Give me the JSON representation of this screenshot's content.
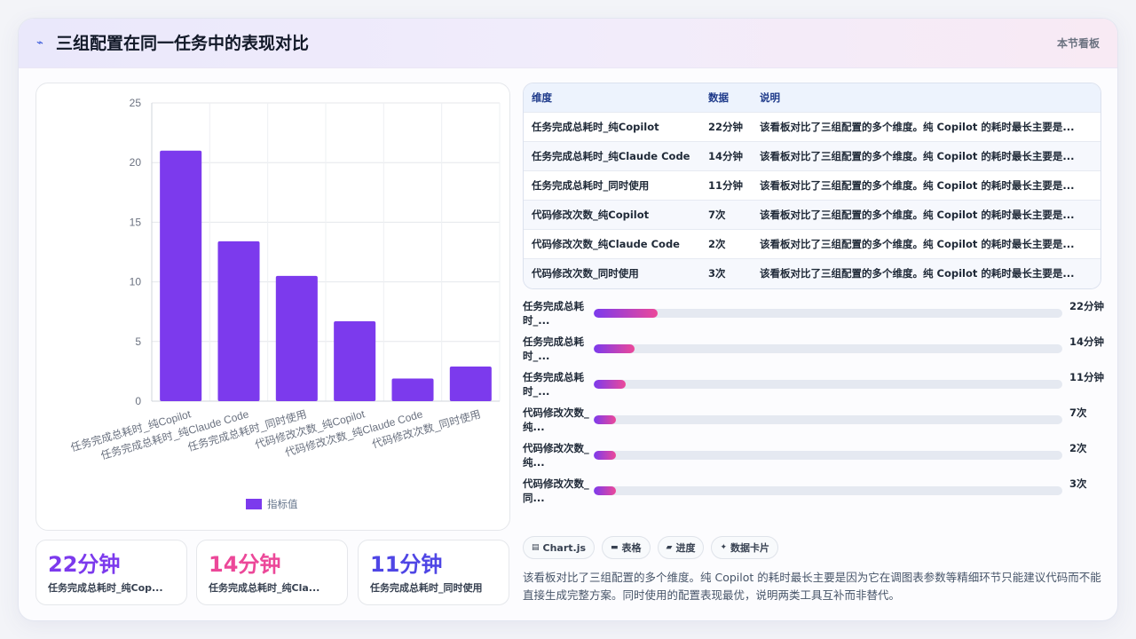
{
  "header": {
    "icon": "trend-icon",
    "title": "三组配置在同一任务中的表现对比",
    "tag": "本节看板"
  },
  "chart_data": {
    "type": "bar",
    "categories": [
      "任务完成总耗时_纯Copilot",
      "任务完成总耗时_纯Claude Code",
      "任务完成总耗时_同时使用",
      "代码修改次数_纯Copilot",
      "代码修改次数_纯Claude Code",
      "代码修改次数_同时使用"
    ],
    "series": [
      {
        "name": "指标值",
        "values": [
          21,
          13.4,
          10.5,
          6.7,
          1.9,
          2.9
        ]
      }
    ],
    "ylim": [
      0,
      25
    ],
    "yticks": [
      0,
      5,
      10,
      15,
      20,
      25
    ],
    "ytick_labels": [
      "0",
      "5",
      "10",
      "15",
      "20",
      "25"
    ],
    "grid": true,
    "legend_position": "bottom",
    "color": "#7c3aed"
  },
  "stats": [
    {
      "value": "22分钟",
      "label": "任务完成总耗时_纯Cop...",
      "color": "#7c3aed"
    },
    {
      "value": "14分钟",
      "label": "任务完成总耗时_纯Cla...",
      "color": "#ec4899"
    },
    {
      "value": "11分钟",
      "label": "任务完成总耗时_同时使用",
      "color": "#4f46e5"
    }
  ],
  "table": {
    "headers": [
      "维度",
      "数据",
      "说明"
    ],
    "rows": [
      {
        "dim": "任务完成总耗时_纯Copilot",
        "val": "22分钟",
        "note": "该看板对比了三组配置的多个维度。纯 Copilot 的耗时最长主要是..."
      },
      {
        "dim": "任务完成总耗时_纯Claude Code",
        "val": "14分钟",
        "note": "该看板对比了三组配置的多个维度。纯 Copilot 的耗时最长主要是..."
      },
      {
        "dim": "任务完成总耗时_同时使用",
        "val": "11分钟",
        "note": "该看板对比了三组配置的多个维度。纯 Copilot 的耗时最长主要是..."
      },
      {
        "dim": "代码修改次数_纯Copilot",
        "val": "7次",
        "note": "该看板对比了三组配置的多个维度。纯 Copilot 的耗时最长主要是..."
      },
      {
        "dim": "代码修改次数_纯Claude Code",
        "val": "2次",
        "note": "该看板对比了三组配置的多个维度。纯 Copilot 的耗时最长主要是..."
      },
      {
        "dim": "代码修改次数_同时使用",
        "val": "3次",
        "note": "该看板对比了三组配置的多个维度。纯 Copilot 的耗时最长主要是..."
      }
    ]
  },
  "progress": [
    {
      "label": "任务完成总耗时_...",
      "value": "22分钟",
      "fraction": 0.136
    },
    {
      "label": "任务完成总耗时_...",
      "value": "14分钟",
      "fraction": 0.087
    },
    {
      "label": "任务完成总耗时_...",
      "value": "11分钟",
      "fraction": 0.068
    },
    {
      "label": "代码修改次数_纯...",
      "value": "7次",
      "fraction": 0.048
    },
    {
      "label": "代码修改次数_纯...",
      "value": "2次",
      "fraction": 0.048
    },
    {
      "label": "代码修改次数_同...",
      "value": "3次",
      "fraction": 0.048
    }
  ],
  "chips": [
    {
      "icon": "chart-icon",
      "glyph": "▤",
      "label": "Chart.js"
    },
    {
      "icon": "table-icon",
      "glyph": "▬",
      "label": "表格"
    },
    {
      "icon": "progress-icon",
      "glyph": "▰",
      "label": "进度"
    },
    {
      "icon": "card-icon",
      "glyph": "✦",
      "label": "数据卡片"
    }
  ],
  "description": "该看板对比了三组配置的多个维度。纯 Copilot 的耗时最长主要是因为它在调图表参数等精细环节只能建议代码而不能直接生成完整方案。同时使用的配置表现最优，说明两类工具互补而非替代。"
}
